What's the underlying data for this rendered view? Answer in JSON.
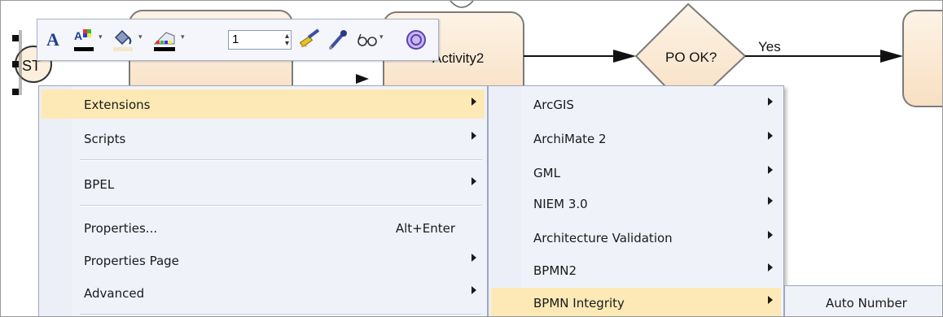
{
  "diagram": {
    "start_label": "ST",
    "activity_label": "Activity2",
    "decision_label": "PO OK?",
    "flow_label": "Yes"
  },
  "toolbar": {
    "line_width_value": "1"
  },
  "context_menu": {
    "items": [
      {
        "label": "Extensions",
        "has_submenu": true,
        "highlighted": true
      },
      {
        "label": "Scripts",
        "has_submenu": true
      },
      {
        "label": "BPEL",
        "has_submenu": true
      },
      {
        "label": "Properties...",
        "shortcut": "Alt+Enter"
      },
      {
        "label": "Properties Page",
        "has_submenu": true
      },
      {
        "label": "Advanced",
        "has_submenu": true
      }
    ]
  },
  "extensions_menu": {
    "items": [
      {
        "label": "ArcGIS"
      },
      {
        "label": "ArchiMate 2"
      },
      {
        "label": "GML"
      },
      {
        "label": "NIEM 3.0"
      },
      {
        "label": "Architecture Validation"
      },
      {
        "label": "BPMN2"
      },
      {
        "label": "BPMN Integrity",
        "highlighted": true
      }
    ]
  },
  "bpmn_integrity_menu": {
    "items": [
      {
        "label": "Auto Number"
      }
    ]
  },
  "colors": {
    "menu_highlight": "#fde9b5",
    "menu_background": "#f0f2fa",
    "shape_fill": "#fbe6cc",
    "shape_border": "#7b7b7b"
  }
}
